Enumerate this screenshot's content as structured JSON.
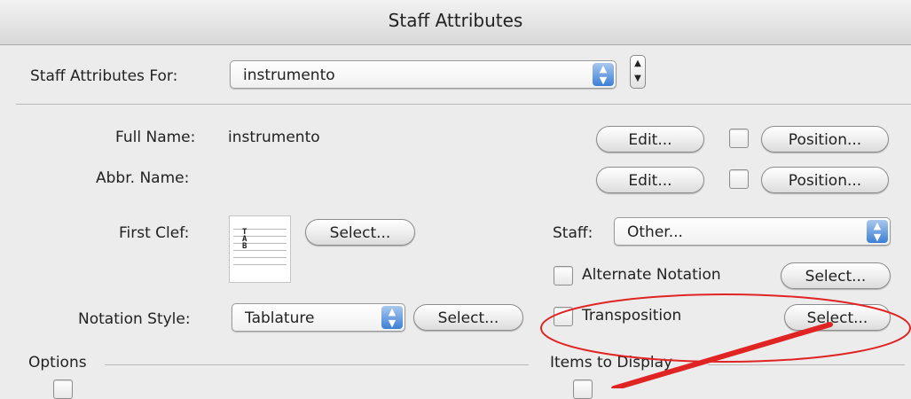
{
  "window": {
    "title": "Staff Attributes"
  },
  "staff_for": {
    "label": "Staff Attributes For:",
    "value": "instrumento"
  },
  "full_name": {
    "label": "Full Name:",
    "value": "instrumento",
    "edit_label": "Edit...",
    "position_label": "Position..."
  },
  "abbr_name": {
    "label": "Abbr. Name:",
    "value": "",
    "edit_label": "Edit...",
    "position_label": "Position..."
  },
  "first_clef": {
    "label": "First Clef:",
    "select_label": "Select...",
    "clef_glyph": "TAB"
  },
  "staff": {
    "label": "Staff:",
    "value": "Other..."
  },
  "alternate_notation": {
    "label": "Alternate Notation",
    "select_label": "Select..."
  },
  "notation_style": {
    "label": "Notation Style:",
    "value": "Tablature",
    "select_label": "Select..."
  },
  "transposition": {
    "label": "Transposition",
    "select_label": "Select..."
  },
  "options": {
    "label": "Options"
  },
  "items_to_display": {
    "label": "Items to Display"
  },
  "colors": {
    "accent": "#3d7fd6",
    "annotation": "#e02424"
  }
}
